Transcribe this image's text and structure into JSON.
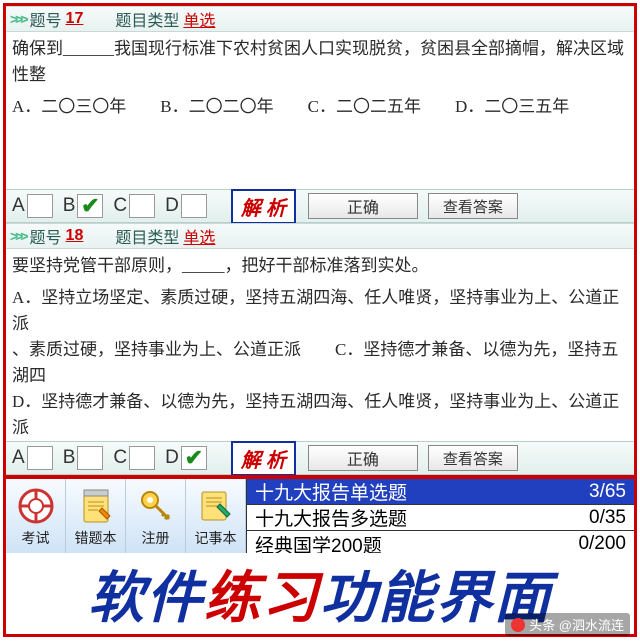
{
  "q1": {
    "num": "17",
    "num_label": "题号",
    "type_label": "题目类型",
    "type": "单选",
    "stem": "确保到______我国现行标准下农村贫困人口实现脱贫，贫困县全部摘帽，解决区域性整",
    "options_line": "A．二〇三〇年　　B．二〇二〇年　　C．二〇二五年　　D．二〇三五年",
    "selected": "B"
  },
  "q2": {
    "num": "18",
    "num_label": "题号",
    "type_label": "题目类型",
    "type": "单选",
    "stem": "要坚持党管干部原则，_____，把好干部标准落到实处。",
    "opt_a": "A．坚持立场坚定、素质过硬，坚持五湖四海、任人唯贤，坚持事业为上、公道正派",
    "opt_b": "、素质过硬，坚持事业为上、公道正派　　C．坚持德才兼备、以德为先，坚持五湖四",
    "opt_d": "D．坚持德才兼备、以德为先，坚持五湖四海、任人唯贤，坚持事业为上、公道正派",
    "selected": "D"
  },
  "answerbar": {
    "a": "A",
    "b": "B",
    "c": "C",
    "d": "D",
    "analysis": "解 析",
    "correct": "正确",
    "show": "查看答案"
  },
  "toolbar": {
    "exam": "考试",
    "wrongbook": "错题本",
    "register": "注册",
    "notebook": "记事本"
  },
  "progress": {
    "row1_name": "十九大报告单选题",
    "row1_val": "3/65",
    "row2_name": "十九大报告多选题",
    "row2_val": "0/35",
    "row3_name": "经典国学200题",
    "row3_val": "0/200"
  },
  "banner": {
    "t1": "软件",
    "t2": "练习",
    "t3": "功能界面"
  },
  "watermark": "头条 @泗水流连"
}
